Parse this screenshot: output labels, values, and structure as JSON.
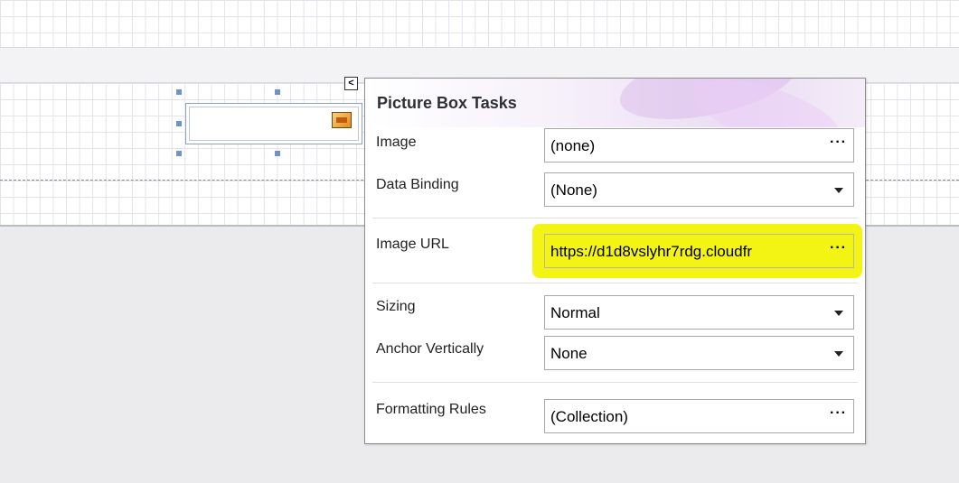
{
  "panel": {
    "title": "Picture Box Tasks",
    "smart_tag_glyph": "<",
    "fields": {
      "image": {
        "label": "Image",
        "value": "(none)",
        "button": "···",
        "icon": "ellipsis-icon"
      },
      "data_binding": {
        "label": "Data Binding",
        "value": "(None)",
        "icon": "chevron-down-icon"
      },
      "image_url": {
        "label": "Image URL",
        "value": "https://d1d8vslyhr7rdg.cloudfr",
        "button": "···",
        "icon": "ellipsis-icon",
        "highlight_color": "#f2f200"
      },
      "sizing": {
        "label": "Sizing",
        "value": "Normal",
        "icon": "chevron-down-icon"
      },
      "anchor_vertically": {
        "label": "Anchor Vertically",
        "value": "None",
        "icon": "chevron-down-icon"
      },
      "formatting_rules": {
        "label": "Formatting Rules",
        "value": "(Collection)",
        "button": "···",
        "icon": "ellipsis-icon"
      }
    }
  },
  "designer": {
    "picture_box_icon": "picture-icon",
    "grid_color": "#e1e4ea",
    "surface_color": "#ebebed"
  }
}
